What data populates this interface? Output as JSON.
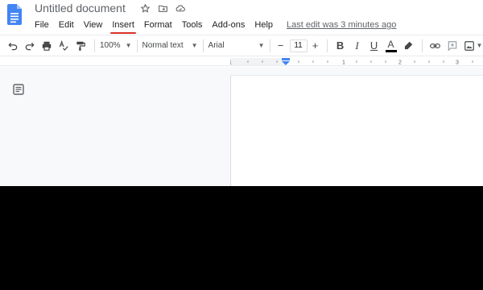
{
  "document": {
    "title": "Untitled document"
  },
  "title_icons": [
    "star-icon",
    "move-to-folder-icon",
    "cloud-status-icon"
  ],
  "menu": {
    "items": [
      "File",
      "Edit",
      "View",
      "Insert",
      "Format",
      "Tools",
      "Add-ons",
      "Help"
    ],
    "active": "Insert",
    "last_edit": "Last edit was 3 minutes ago"
  },
  "toolbar": {
    "zoom": "100%",
    "style": "Normal text",
    "font": "Arial",
    "font_size": "11",
    "minus": "−",
    "plus": "+",
    "bold": "B",
    "italic": "I",
    "underline": "U",
    "text_color_label": "A"
  },
  "ruler": {
    "labels": [
      "1",
      "1",
      "2",
      "3"
    ]
  },
  "colors": {
    "accent_blue": "#4285f4",
    "menu_underline": "#d93025",
    "background": "#f8f9fa"
  }
}
